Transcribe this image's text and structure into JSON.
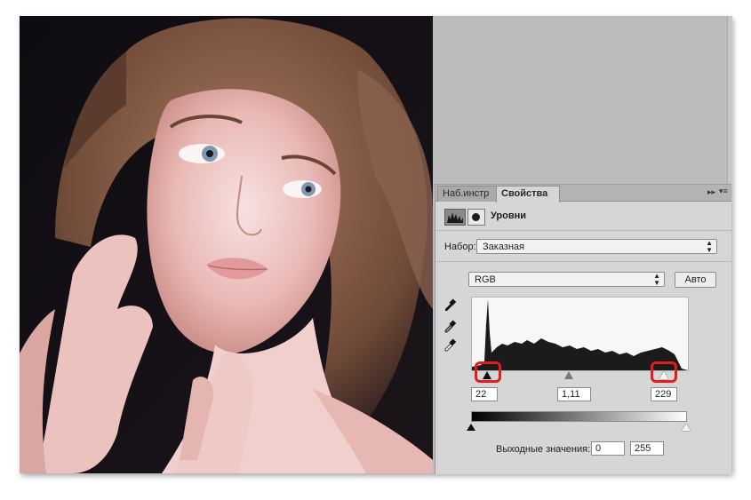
{
  "panel": {
    "tabs": [
      {
        "label": "Наб.инстр",
        "active": false
      },
      {
        "label": "Свойства",
        "active": true
      }
    ],
    "tab_controls": {
      "collapse": "▸▸",
      "menu": "▾≡"
    },
    "header": {
      "title": "Уровни",
      "icons": [
        "levels-adjustment-icon",
        "layer-mask-icon"
      ]
    },
    "preset": {
      "label": "Набор:",
      "value": "Заказная"
    },
    "channel": {
      "value": "RGB"
    },
    "auto_button": "Авто",
    "eyedroppers": [
      "black-point-eyedropper-icon",
      "gray-point-eyedropper-icon",
      "white-point-eyedropper-icon"
    ],
    "input_levels": {
      "black": "22",
      "gamma": "1,11",
      "white": "229"
    },
    "output": {
      "label": "Выходные значения:",
      "min": "0",
      "max": "255"
    },
    "highlight_color": "#e41b1b",
    "accent_colors": {
      "panel_bg": "#d6d6d6",
      "canvas_bg": "#bcbcbc"
    }
  }
}
